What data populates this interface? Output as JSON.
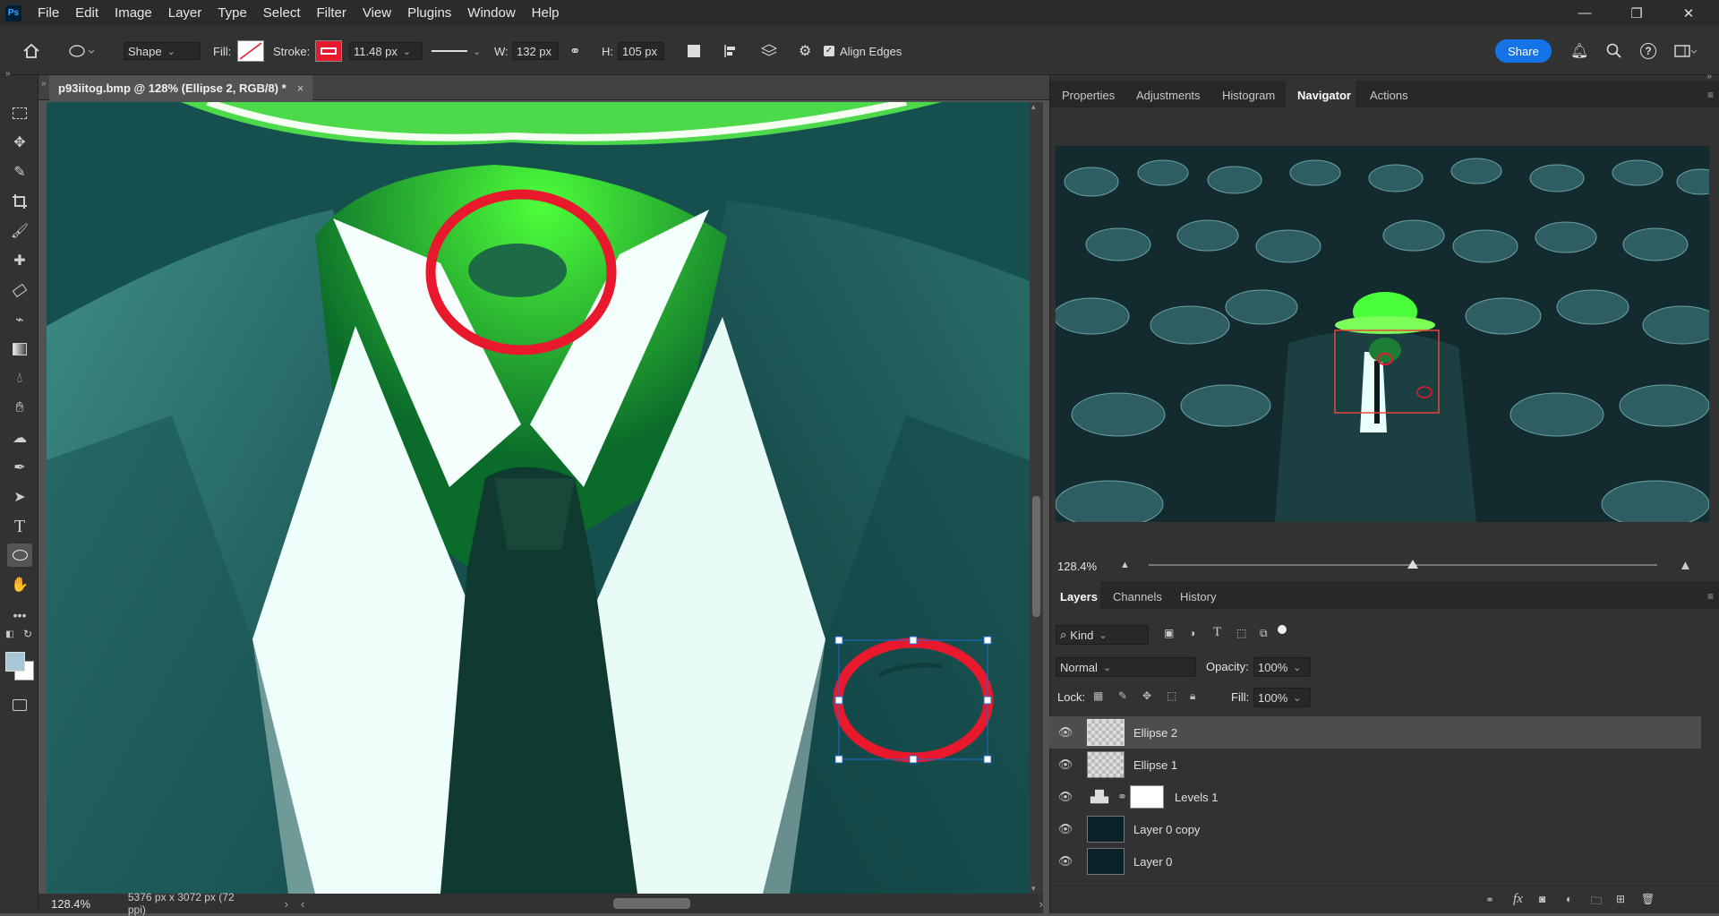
{
  "app": {
    "logo_text": "Ps"
  },
  "menu": [
    "File",
    "Edit",
    "Image",
    "Layer",
    "Type",
    "Select",
    "Filter",
    "View",
    "Plugins",
    "Window",
    "Help"
  ],
  "window_controls": {
    "minimize": "—",
    "restore": "❐",
    "close": "✕"
  },
  "options_bar": {
    "mode": "Shape",
    "fill_label": "Fill:",
    "stroke_label": "Stroke:",
    "stroke_width": "11.48 px",
    "w_label": "W:",
    "w_value": "132 px",
    "h_label": "H:",
    "h_value": "105 px",
    "align_edges_label": "Align Edges",
    "align_edges_checked": true,
    "share_label": "Share",
    "stroke_color": "#e8192c"
  },
  "document": {
    "tab_title": "p93iitog.bmp @ 128% (Ellipse 2, RGB/8) *",
    "close_glyph": "×"
  },
  "status": {
    "zoom": "128.4%",
    "doc_info": "5376 px x 3072 px (72 ppi)"
  },
  "panel_tabs_top": [
    "Properties",
    "Adjustments",
    "Histogram",
    "Navigator",
    "Actions"
  ],
  "navigator": {
    "zoom": "128.4%",
    "zoom_level_fraction": 0.52
  },
  "panel_tabs_bottom": [
    "Layers",
    "Channels",
    "History"
  ],
  "layers_panel": {
    "filter_kind": "Kind",
    "blend_mode": "Normal",
    "opacity_label": "Opacity:",
    "opacity_value": "100%",
    "lock_label": "Lock:",
    "fill_label": "Fill:",
    "fill_value": "100%",
    "layers": [
      {
        "name": "Ellipse 2",
        "selected": true,
        "kind": "shape"
      },
      {
        "name": "Ellipse 1",
        "selected": false,
        "kind": "shape"
      },
      {
        "name": "Levels 1",
        "selected": false,
        "kind": "adjustment"
      },
      {
        "name": "Layer 0 copy",
        "selected": false,
        "kind": "pixel"
      },
      {
        "name": "Layer 0",
        "selected": false,
        "kind": "pixel"
      }
    ]
  },
  "colors": {
    "accent": "#1473e6",
    "annotation_red": "#e8192c"
  }
}
